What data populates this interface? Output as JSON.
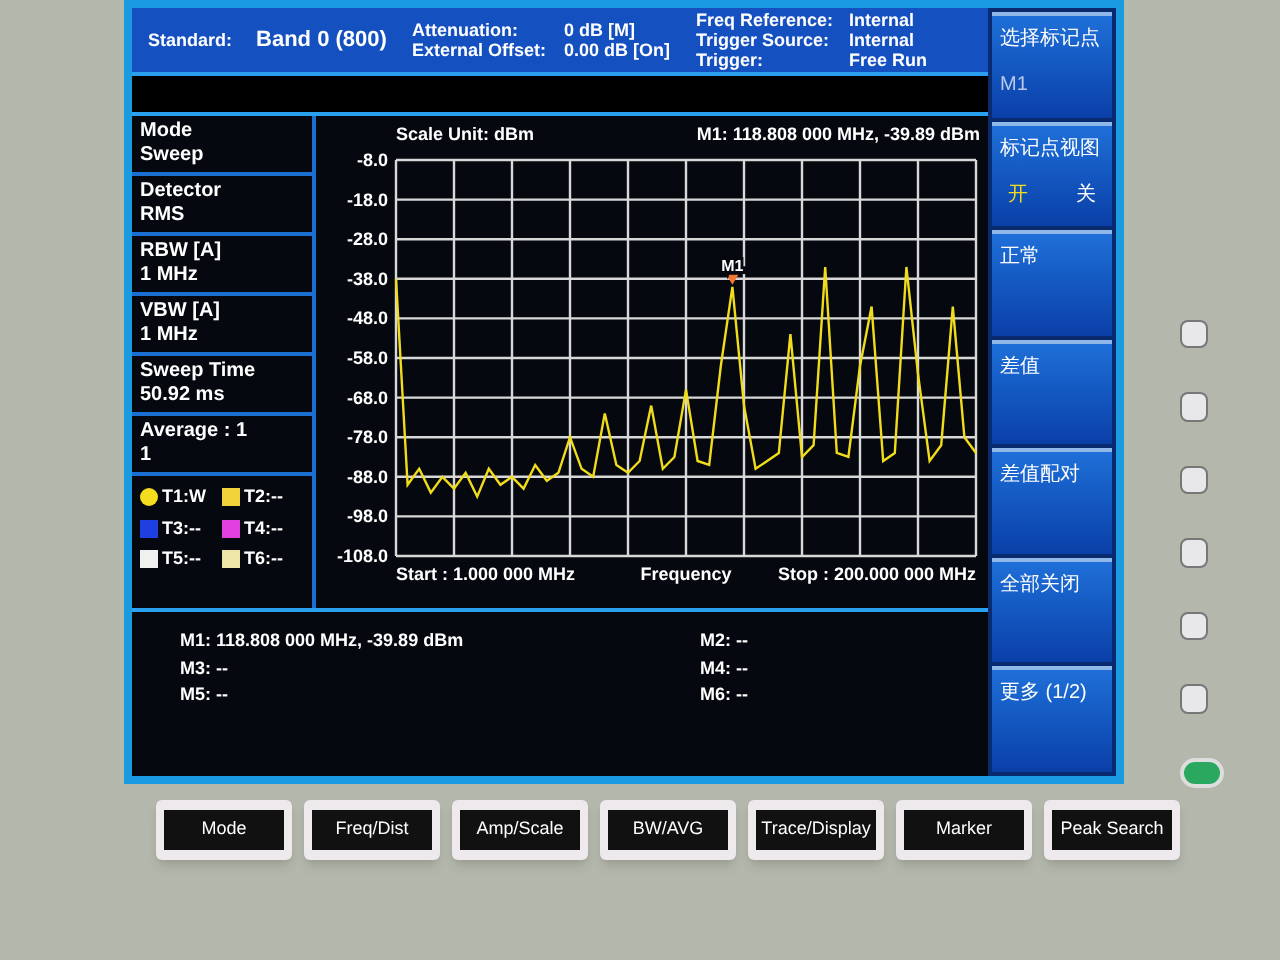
{
  "header": {
    "standard": {
      "label": "Standard:",
      "value": "Band 0 (800)"
    },
    "middle": [
      {
        "label": "Attenuation:",
        "value": "0 dB  [M]"
      },
      {
        "label": "External Offset:",
        "value": "0.00 dB  [On]"
      }
    ],
    "right": [
      {
        "label": "Freq Reference:",
        "value": "Internal"
      },
      {
        "label": "Trigger Source:",
        "value": "Internal"
      },
      {
        "label": "Trigger:",
        "value": "Free Run"
      }
    ]
  },
  "settings": [
    {
      "label": "Mode",
      "value": "Sweep"
    },
    {
      "label": "Detector",
      "value": "RMS"
    },
    {
      "label": "RBW [A]",
      "value": "1 MHz"
    },
    {
      "label": "VBW [A]",
      "value": "1 MHz"
    },
    {
      "label": "Sweep Time",
      "value": "50.92 ms"
    },
    {
      "label": "Average : 1",
      "value": "1"
    }
  ],
  "traces": [
    {
      "label": "T1:W",
      "color": "#f5dc1e",
      "kind": "dot"
    },
    {
      "label": "T2:--",
      "color": "#f2d43a",
      "kind": "square"
    },
    {
      "label": "T3:--",
      "color": "#1f3fe0",
      "kind": "square"
    },
    {
      "label": "T4:--",
      "color": "#e040e0",
      "kind": "square"
    },
    {
      "label": "T5:--",
      "color": "#f0f0f0",
      "kind": "square"
    },
    {
      "label": "T6:--",
      "color": "#eee6a8",
      "kind": "square"
    }
  ],
  "plot": {
    "scale_unit": "Scale Unit: dBm",
    "marker_readout": "M1: 118.808 000 MHz, -39.89 dBm",
    "start": "Start : 1.000 000 MHz",
    "stop": "Stop : 200.000 000 MHz",
    "marker_label": "M1",
    "chart_data": {
      "type": "line",
      "xlabel": "Frequency",
      "grid": true,
      "ylim": [
        -108,
        -8
      ],
      "yticks": [
        {
          "value": -8,
          "label": "-8.0"
        },
        {
          "value": -18,
          "label": "-18.0"
        },
        {
          "value": -28,
          "label": "-28.0"
        },
        {
          "value": -38,
          "label": "-38.0"
        },
        {
          "value": -48,
          "label": "-48.0"
        },
        {
          "value": -58,
          "label": "-58.0"
        },
        {
          "value": -68,
          "label": "-68.0"
        },
        {
          "value": -78,
          "label": "-78.0"
        },
        {
          "value": -88,
          "label": "-88.0"
        },
        {
          "value": -98,
          "label": "-98.0"
        },
        {
          "value": -108,
          "label": "-108.0"
        }
      ],
      "categories": [
        null,
        null,
        null,
        null,
        null,
        null,
        null,
        null,
        null,
        null,
        null,
        null,
        null,
        null,
        null,
        null,
        null,
        null,
        null,
        null,
        null,
        null,
        null,
        null,
        null,
        null,
        null,
        null,
        null,
        null,
        null,
        null,
        null,
        null,
        null,
        null,
        null,
        null,
        null,
        null,
        null,
        null,
        null,
        null,
        null,
        null,
        null,
        null,
        null,
        null,
        null
      ],
      "series": [
        {
          "color": "#f0dc1a",
          "values": [
            -38,
            -90,
            -86,
            -92,
            -88,
            -91,
            -87,
            -93,
            -86,
            -90,
            -88,
            -91,
            -85,
            -89,
            -87,
            -78,
            -86,
            -88,
            -72,
            -85,
            -87,
            -84,
            -70,
            -86,
            -83,
            -66,
            -84,
            -85,
            -60,
            -40,
            -70,
            -86,
            -84,
            -82,
            -52,
            -83,
            -80,
            -35,
            -82,
            -83,
            -60,
            -45,
            -84,
            -82,
            -35,
            -62,
            -84,
            -80,
            -45,
            -78,
            -82
          ]
        }
      ]
    }
  },
  "markers": {
    "left": [
      "M1: 118.808 000 MHz, -39.89 dBm",
      "M3: --",
      "M5: --"
    ],
    "right": [
      "M2: --",
      "M4: --",
      "M6: --"
    ]
  },
  "softkeys": [
    {
      "label": "选择标记点",
      "value": "M1",
      "kind": "value"
    },
    {
      "label": "标记点视图",
      "on_label": "开",
      "off_label": "关",
      "on": true,
      "kind": "toggle"
    },
    {
      "label": "正常",
      "kind": "plain"
    },
    {
      "label": "差值",
      "kind": "plain"
    },
    {
      "label": "差值配对",
      "kind": "plain"
    },
    {
      "label": "全部关闭",
      "kind": "plain"
    },
    {
      "label": "更多 (1/2)",
      "kind": "plain"
    }
  ],
  "hard_keys": [
    "Mode",
    "Freq/Dist",
    "Amp/Scale",
    "BW/AVG",
    "Trace/Display",
    "Marker",
    "Peak Search"
  ]
}
